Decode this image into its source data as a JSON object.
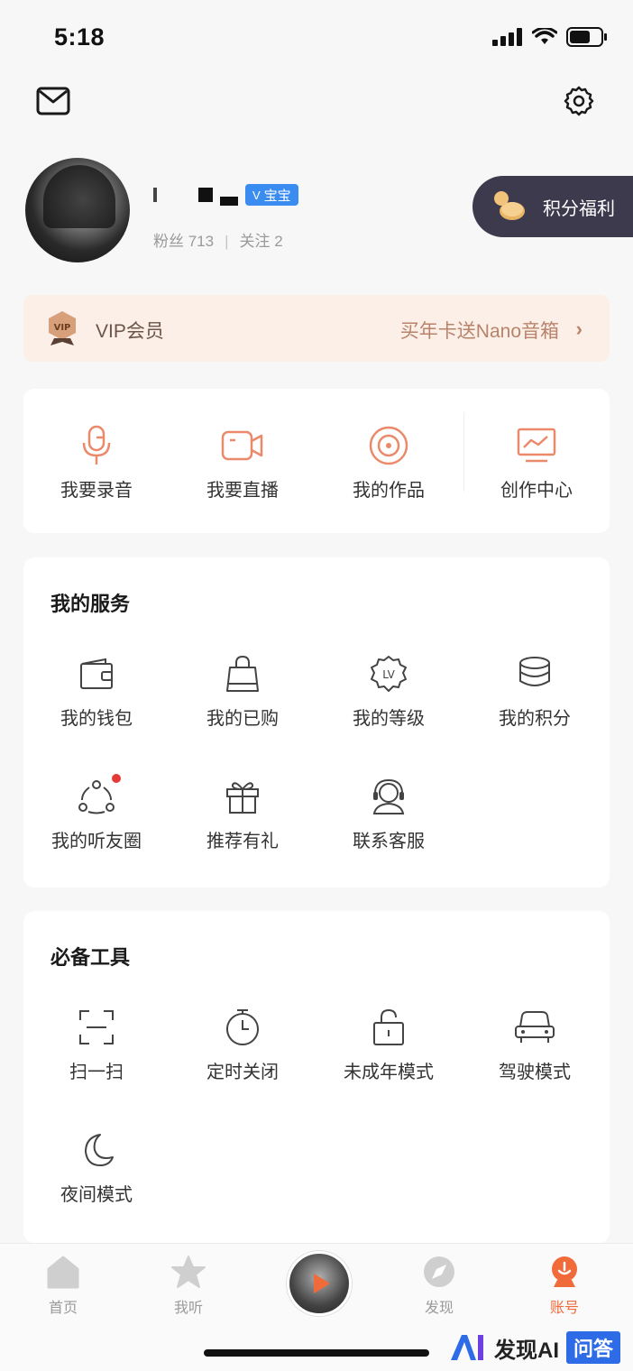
{
  "status_bar": {
    "time": "5:18"
  },
  "profile": {
    "nickname_badge": "宝宝",
    "fans_label": "粉丝 713",
    "follow_label": "关注 2",
    "points_button": "积分福利"
  },
  "vip": {
    "title": "VIP会员",
    "promo": "买年卡送Nano音箱"
  },
  "creator": {
    "items": [
      {
        "label": "我要录音",
        "icon": "microphone-icon"
      },
      {
        "label": "我要直播",
        "icon": "video-camera-icon"
      },
      {
        "label": "我的作品",
        "icon": "disc-icon"
      },
      {
        "label": "创作中心",
        "icon": "monitor-chart-icon"
      }
    ]
  },
  "services": {
    "title": "我的服务",
    "items": [
      {
        "label": "我的钱包",
        "icon": "wallet-icon"
      },
      {
        "label": "我的已购",
        "icon": "shopping-bag-icon"
      },
      {
        "label": "我的等级",
        "icon": "level-badge-icon"
      },
      {
        "label": "我的积分",
        "icon": "coins-stack-icon"
      },
      {
        "label": "我的听友圈",
        "icon": "friends-circle-icon"
      },
      {
        "label": "推荐有礼",
        "icon": "gift-icon"
      },
      {
        "label": "联系客服",
        "icon": "headset-icon"
      }
    ]
  },
  "tools": {
    "title": "必备工具",
    "items": [
      {
        "label": "扫一扫",
        "icon": "scan-icon"
      },
      {
        "label": "定时关闭",
        "icon": "timer-icon"
      },
      {
        "label": "未成年模式",
        "icon": "lock-icon"
      },
      {
        "label": "驾驶模式",
        "icon": "car-icon"
      },
      {
        "label": "夜间模式",
        "icon": "moon-icon"
      }
    ]
  },
  "tabbar": {
    "tabs": [
      {
        "label": "首页",
        "icon": "home-icon"
      },
      {
        "label": "我听",
        "icon": "star-icon"
      },
      {
        "label": "发现",
        "icon": "compass-icon"
      },
      {
        "label": "账号",
        "icon": "account-icon"
      }
    ],
    "active_color": "#f06a3a"
  },
  "watermark": {
    "brand": "发现AI",
    "sub": "问答"
  }
}
